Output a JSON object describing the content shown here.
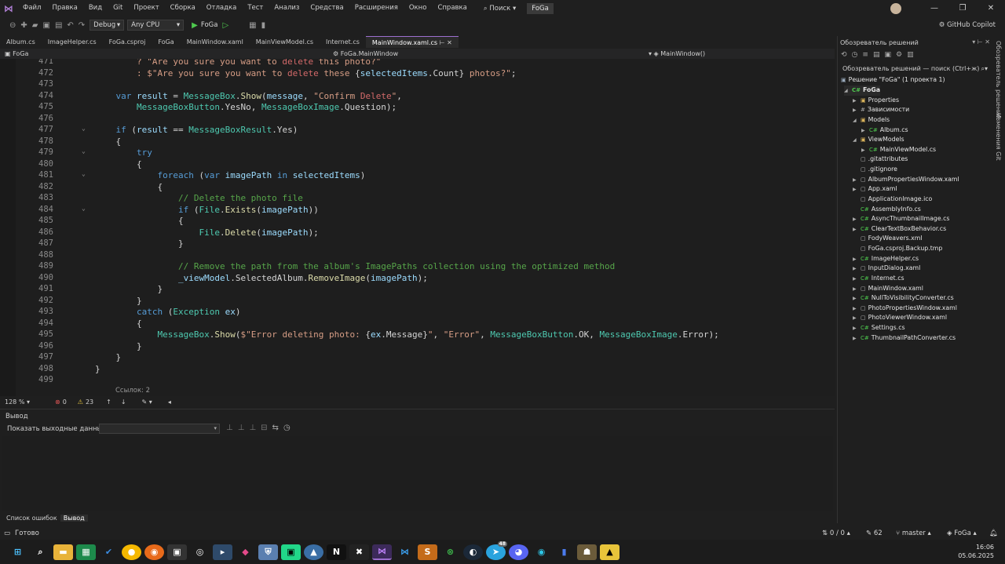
{
  "menubar": {
    "items": [
      "Файл",
      "Правка",
      "Вид",
      "Git",
      "Проект",
      "Сборка",
      "Отладка",
      "Тест",
      "Анализ",
      "Средства",
      "Расширения",
      "Окно",
      "Справка"
    ],
    "search_label": "Поиск",
    "solution_name": "FoGa"
  },
  "toolbar": {
    "config": "Debug",
    "platform": "Any CPU",
    "run_label": "FoGa",
    "copilot": "GitHub Copilot"
  },
  "tabs": [
    {
      "label": "Album.cs",
      "active": false
    },
    {
      "label": "ImageHelper.cs",
      "active": false
    },
    {
      "label": "FoGa.csproj",
      "active": false
    },
    {
      "label": "FoGa",
      "active": false
    },
    {
      "label": "MainWindow.xaml",
      "active": false
    },
    {
      "label": "MainViewModel.cs",
      "active": false
    },
    {
      "label": "Internet.cs",
      "active": false
    },
    {
      "label": "MainWindow.xaml.cs",
      "active": true
    }
  ],
  "navbar": {
    "project": "FoGa",
    "class": "FoGa.MainWindow",
    "member": "MainWindow()"
  },
  "editor": {
    "line_numbers": [
      "471",
      "472",
      "473",
      "474",
      "475",
      "476",
      "477",
      "478",
      "479",
      "480",
      "481",
      "482",
      "483",
      "484",
      "485",
      "486",
      "487",
      "488",
      "489",
      "490",
      "491",
      "492",
      "493",
      "494",
      "495",
      "496",
      "497",
      "498",
      "499"
    ],
    "refs_label": "Ссылок: 2",
    "zoom": "128 %",
    "errors": "0",
    "warnings": "23"
  },
  "output": {
    "title": "Вывод",
    "show_from_label": "Показать выходные данные из:"
  },
  "bottom_tabs": {
    "errors_tab": "Список ошибок",
    "output_tab": "Вывод"
  },
  "statusbar": {
    "ready": "Готово",
    "changes": "0 / 0",
    "edits": "62",
    "branch": "master",
    "repo": "FoGa"
  },
  "solution_explorer": {
    "title": "Обозреватель решений",
    "search_placeholder": "Обозреватель решений — поиск (Ctrl+ж)",
    "solution": "Решение \"FoGa\"  (1 проекта 1)",
    "items": [
      {
        "label": "FoGa",
        "level": 1,
        "arrow": "◢",
        "icon": "C#"
      },
      {
        "label": "Properties",
        "level": 2,
        "arrow": "▶",
        "icon": "▣"
      },
      {
        "label": "Зависимости",
        "level": 2,
        "arrow": "▶",
        "icon": "#"
      },
      {
        "label": "Models",
        "level": 2,
        "arrow": "◢",
        "icon": "▣"
      },
      {
        "label": "Album.cs",
        "level": 3,
        "arrow": "▶",
        "icon": "C#"
      },
      {
        "label": "ViewModels",
        "level": 2,
        "arrow": "◢",
        "icon": "▣"
      },
      {
        "label": "MainViewModel.cs",
        "level": 3,
        "arrow": "▶",
        "icon": "C#"
      },
      {
        "label": ".gitattributes",
        "level": 2,
        "arrow": "",
        "icon": "▢"
      },
      {
        "label": ".gitignore",
        "level": 2,
        "arrow": "",
        "icon": "▢"
      },
      {
        "label": "AlbumPropertiesWindow.xaml",
        "level": 2,
        "arrow": "▶",
        "icon": "▢"
      },
      {
        "label": "App.xaml",
        "level": 2,
        "arrow": "▶",
        "icon": "▢"
      },
      {
        "label": "ApplicationImage.ico",
        "level": 2,
        "arrow": "",
        "icon": "▢"
      },
      {
        "label": "AssemblyInfo.cs",
        "level": 2,
        "arrow": "",
        "icon": "C#"
      },
      {
        "label": "AsyncThumbnailImage.cs",
        "level": 2,
        "arrow": "▶",
        "icon": "C#"
      },
      {
        "label": "ClearTextBoxBehavior.cs",
        "level": 2,
        "arrow": "▶",
        "icon": "C#"
      },
      {
        "label": "FodyWeavers.xml",
        "level": 2,
        "arrow": "",
        "icon": "▢"
      },
      {
        "label": "FoGa.csproj.Backup.tmp",
        "level": 2,
        "arrow": "",
        "icon": "▢"
      },
      {
        "label": "ImageHelper.cs",
        "level": 2,
        "arrow": "▶",
        "icon": "C#"
      },
      {
        "label": "InputDialog.xaml",
        "level": 2,
        "arrow": "▶",
        "icon": "▢"
      },
      {
        "label": "Internet.cs",
        "level": 2,
        "arrow": "▶",
        "icon": "C#"
      },
      {
        "label": "MainWindow.xaml",
        "level": 2,
        "arrow": "▶",
        "icon": "▢"
      },
      {
        "label": "NullToVisibilityConverter.cs",
        "level": 2,
        "arrow": "▶",
        "icon": "C#"
      },
      {
        "label": "PhotoPropertiesWindow.xaml",
        "level": 2,
        "arrow": "▶",
        "icon": "▢"
      },
      {
        "label": "PhotoViewerWindow.xaml",
        "level": 2,
        "arrow": "▶",
        "icon": "▢"
      },
      {
        "label": "Settings.cs",
        "level": 2,
        "arrow": "▶",
        "icon": "C#"
      },
      {
        "label": "ThumbnailPathConverter.cs",
        "level": 2,
        "arrow": "▶",
        "icon": "C#"
      }
    ]
  },
  "side_panels": {
    "solution_explorer_vertical": "Обозреватель решений",
    "git_changes_vertical": "Изменения Git"
  },
  "taskbar": {
    "time": "16:06",
    "date": "05.06.2025",
    "telegram_badge": "48"
  },
  "colors": {
    "accent": "#9d6fd0",
    "background": "#1e1e1e",
    "keyword": "#569cd6",
    "type": "#4ec9b0",
    "string": "#d69d85",
    "comment": "#57a64a"
  }
}
